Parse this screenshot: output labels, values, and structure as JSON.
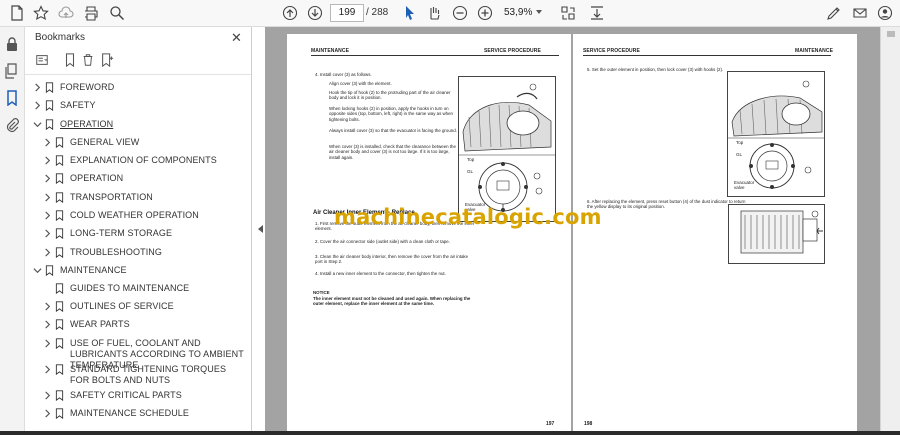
{
  "toolbar": {
    "page_current": "199",
    "page_total": "/ 288",
    "zoom": "53,9%"
  },
  "bookmarks": {
    "title": "Bookmarks",
    "items": [
      {
        "label": "FOREWORD",
        "level": 0,
        "expanded": false
      },
      {
        "label": "SAFETY",
        "level": 0,
        "expanded": false
      },
      {
        "label": "OPERATION",
        "level": 0,
        "expanded": true,
        "selected": true
      },
      {
        "label": "GENERAL VIEW",
        "level": 1,
        "expanded": false
      },
      {
        "label": "EXPLANATION OF COMPONENTS",
        "level": 1,
        "expanded": false
      },
      {
        "label": "OPERATION",
        "level": 1,
        "expanded": false
      },
      {
        "label": "TRANSPORTATION",
        "level": 1,
        "expanded": false
      },
      {
        "label": "COLD WEATHER OPERATION",
        "level": 1,
        "expanded": false
      },
      {
        "label": "LONG-TERM STORAGE",
        "level": 1,
        "expanded": false
      },
      {
        "label": "TROUBLESHOOTING",
        "level": 1,
        "expanded": false
      },
      {
        "label": "MAINTENANCE",
        "level": 0,
        "expanded": true
      },
      {
        "label": "GUIDES TO MAINTENANCE",
        "level": 1,
        "expanded": false,
        "leaf": true
      },
      {
        "label": "OUTLINES OF SERVICE",
        "level": 1,
        "expanded": false
      },
      {
        "label": "WEAR PARTS",
        "level": 1,
        "expanded": false
      },
      {
        "label": "USE OF FUEL, COOLANT AND LUBRICANTS ACCORDING TO AMBIENT TEMPERATURE",
        "level": 1,
        "expanded": false
      },
      {
        "label": "STANDARD TIGHTENING TORQUES FOR BOLTS AND NUTS",
        "level": 1,
        "expanded": false
      },
      {
        "label": "SAFETY CRITICAL PARTS",
        "level": 1,
        "expanded": false
      },
      {
        "label": "MAINTENANCE SCHEDULE",
        "level": 1,
        "expanded": false
      }
    ]
  },
  "left_page": {
    "header_left": "MAINTENANCE",
    "header_right": "SERVICE PROCEDURE",
    "step4": "4.   Install cover (3) as follows.",
    "bullets": [
      "Align cover (3) with the element.",
      "Hook the tip of hook (2) to the protruding part of the air cleaner body and lock it in position.",
      "When locking hooks (2) in position, apply the hooks in turn on opposite sides (top, bottom, left, right) in the same way as when tightening bolts.",
      "Always install cover (3) so that the evacuator is facing the ground.",
      "When cover (3) is installed, check that the clearance between the air cleaner body and cover (3) is not too large.  If it is too large, install again."
    ],
    "section_title": "Air Cleaner Inner Element - Replace",
    "steps": [
      "1.   First remove the outer element from the air cleaner body, then remove the inner element.",
      "2.   Cover the air connector side (outlet side) with a clean cloth or tape.",
      "3.   Clean the air cleaner body interior, then remove the cover from the air intake port in Step 2.",
      "4.   Install a new inner element to the connector, then tighten the nut."
    ],
    "notice_title": "NOTICE",
    "notice_text": "The inner element must not be cleaned and used again. When replacing the outer element, replace the inner element at the same time.",
    "fig_top_label": "Top",
    "fig_gl_label": "GL",
    "fig_evacuator": "Evacuator valve",
    "page_number": "197"
  },
  "right_page": {
    "header_left": "SERVICE PROCEDURE",
    "header_right": "MAINTENANCE",
    "step5": "5.   Set the outer element in position, then lock cover (3) with hooks (2).",
    "step6": "6.   After replacing the element, press reset button (4) of the dust indicator to return the yellow display to its original position.",
    "fig_top_label": "Top",
    "fig_gl_label": "GL",
    "fig_evacuator": "Evacuator valve",
    "page_number": "198"
  },
  "watermark": "machinecatalogic.com",
  "colors": {
    "accent": "#1f5fb6",
    "doc_background": "#a3a3a3",
    "watermark": "#d9a400"
  }
}
